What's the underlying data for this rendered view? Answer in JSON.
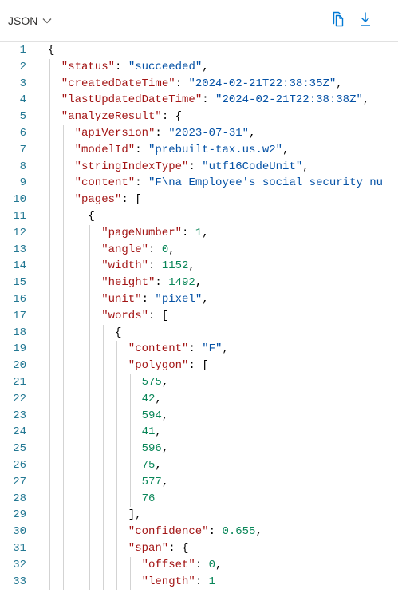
{
  "toolbar": {
    "format_label": "JSON",
    "format_chevron_icon": "chevron-down-icon",
    "copy_icon": "copy-icon",
    "download_icon": "download-icon"
  },
  "colors": {
    "key": "#a31515",
    "string": "#0451a5",
    "number": "#098658",
    "line_number": "#237893",
    "icon": "#0078d4"
  },
  "lines": [
    {
      "n": "1",
      "indent": 0,
      "tokens": [
        {
          "t": "{",
          "c": "p"
        }
      ]
    },
    {
      "n": "2",
      "indent": 1,
      "tokens": [
        {
          "t": "\"status\"",
          "c": "k"
        },
        {
          "t": ": ",
          "c": "p"
        },
        {
          "t": "\"succeeded\"",
          "c": "s"
        },
        {
          "t": ",",
          "c": "p"
        }
      ]
    },
    {
      "n": "3",
      "indent": 1,
      "tokens": [
        {
          "t": "\"createdDateTime\"",
          "c": "k"
        },
        {
          "t": ": ",
          "c": "p"
        },
        {
          "t": "\"2024-02-21T22:38:35Z\"",
          "c": "s"
        },
        {
          "t": ",",
          "c": "p"
        }
      ]
    },
    {
      "n": "4",
      "indent": 1,
      "tokens": [
        {
          "t": "\"lastUpdatedDateTime\"",
          "c": "k"
        },
        {
          "t": ": ",
          "c": "p"
        },
        {
          "t": "\"2024-02-21T22:38:38Z\"",
          "c": "s"
        },
        {
          "t": ",",
          "c": "p"
        }
      ]
    },
    {
      "n": "5",
      "indent": 1,
      "tokens": [
        {
          "t": "\"analyzeResult\"",
          "c": "k"
        },
        {
          "t": ": {",
          "c": "p"
        }
      ]
    },
    {
      "n": "6",
      "indent": 2,
      "tokens": [
        {
          "t": "\"apiVersion\"",
          "c": "k"
        },
        {
          "t": ": ",
          "c": "p"
        },
        {
          "t": "\"2023-07-31\"",
          "c": "s"
        },
        {
          "t": ",",
          "c": "p"
        }
      ]
    },
    {
      "n": "7",
      "indent": 2,
      "tokens": [
        {
          "t": "\"modelId\"",
          "c": "k"
        },
        {
          "t": ": ",
          "c": "p"
        },
        {
          "t": "\"prebuilt-tax.us.w2\"",
          "c": "s"
        },
        {
          "t": ",",
          "c": "p"
        }
      ]
    },
    {
      "n": "8",
      "indent": 2,
      "tokens": [
        {
          "t": "\"stringIndexType\"",
          "c": "k"
        },
        {
          "t": ": ",
          "c": "p"
        },
        {
          "t": "\"utf16CodeUnit\"",
          "c": "s"
        },
        {
          "t": ",",
          "c": "p"
        }
      ]
    },
    {
      "n": "9",
      "indent": 2,
      "tokens": [
        {
          "t": "\"content\"",
          "c": "k"
        },
        {
          "t": ": ",
          "c": "p"
        },
        {
          "t": "\"F\\na Employee's social security nu",
          "c": "s"
        }
      ]
    },
    {
      "n": "10",
      "indent": 2,
      "tokens": [
        {
          "t": "\"pages\"",
          "c": "k"
        },
        {
          "t": ": [",
          "c": "p"
        }
      ]
    },
    {
      "n": "11",
      "indent": 3,
      "tokens": [
        {
          "t": "{",
          "c": "p"
        }
      ]
    },
    {
      "n": "12",
      "indent": 4,
      "tokens": [
        {
          "t": "\"pageNumber\"",
          "c": "k"
        },
        {
          "t": ": ",
          "c": "p"
        },
        {
          "t": "1",
          "c": "n"
        },
        {
          "t": ",",
          "c": "p"
        }
      ]
    },
    {
      "n": "13",
      "indent": 4,
      "tokens": [
        {
          "t": "\"angle\"",
          "c": "k"
        },
        {
          "t": ": ",
          "c": "p"
        },
        {
          "t": "0",
          "c": "n"
        },
        {
          "t": ",",
          "c": "p"
        }
      ]
    },
    {
      "n": "14",
      "indent": 4,
      "tokens": [
        {
          "t": "\"width\"",
          "c": "k"
        },
        {
          "t": ": ",
          "c": "p"
        },
        {
          "t": "1152",
          "c": "n"
        },
        {
          "t": ",",
          "c": "p"
        }
      ]
    },
    {
      "n": "15",
      "indent": 4,
      "tokens": [
        {
          "t": "\"height\"",
          "c": "k"
        },
        {
          "t": ": ",
          "c": "p"
        },
        {
          "t": "1492",
          "c": "n"
        },
        {
          "t": ",",
          "c": "p"
        }
      ]
    },
    {
      "n": "16",
      "indent": 4,
      "tokens": [
        {
          "t": "\"unit\"",
          "c": "k"
        },
        {
          "t": ": ",
          "c": "p"
        },
        {
          "t": "\"pixel\"",
          "c": "s"
        },
        {
          "t": ",",
          "c": "p"
        }
      ]
    },
    {
      "n": "17",
      "indent": 4,
      "tokens": [
        {
          "t": "\"words\"",
          "c": "k"
        },
        {
          "t": ": [",
          "c": "p"
        }
      ]
    },
    {
      "n": "18",
      "indent": 5,
      "tokens": [
        {
          "t": "{",
          "c": "p"
        }
      ]
    },
    {
      "n": "19",
      "indent": 6,
      "tokens": [
        {
          "t": "\"content\"",
          "c": "k"
        },
        {
          "t": ": ",
          "c": "p"
        },
        {
          "t": "\"F\"",
          "c": "s"
        },
        {
          "t": ",",
          "c": "p"
        }
      ]
    },
    {
      "n": "20",
      "indent": 6,
      "tokens": [
        {
          "t": "\"polygon\"",
          "c": "k"
        },
        {
          "t": ": [",
          "c": "p"
        }
      ]
    },
    {
      "n": "21",
      "indent": 7,
      "tokens": [
        {
          "t": "575",
          "c": "n"
        },
        {
          "t": ",",
          "c": "p"
        }
      ]
    },
    {
      "n": "22",
      "indent": 7,
      "tokens": [
        {
          "t": "42",
          "c": "n"
        },
        {
          "t": ",",
          "c": "p"
        }
      ]
    },
    {
      "n": "23",
      "indent": 7,
      "tokens": [
        {
          "t": "594",
          "c": "n"
        },
        {
          "t": ",",
          "c": "p"
        }
      ]
    },
    {
      "n": "24",
      "indent": 7,
      "tokens": [
        {
          "t": "41",
          "c": "n"
        },
        {
          "t": ",",
          "c": "p"
        }
      ]
    },
    {
      "n": "25",
      "indent": 7,
      "tokens": [
        {
          "t": "596",
          "c": "n"
        },
        {
          "t": ",",
          "c": "p"
        }
      ]
    },
    {
      "n": "26",
      "indent": 7,
      "tokens": [
        {
          "t": "75",
          "c": "n"
        },
        {
          "t": ",",
          "c": "p"
        }
      ]
    },
    {
      "n": "27",
      "indent": 7,
      "tokens": [
        {
          "t": "577",
          "c": "n"
        },
        {
          "t": ",",
          "c": "p"
        }
      ]
    },
    {
      "n": "28",
      "indent": 7,
      "tokens": [
        {
          "t": "76",
          "c": "n"
        }
      ]
    },
    {
      "n": "29",
      "indent": 6,
      "tokens": [
        {
          "t": "],",
          "c": "p"
        }
      ]
    },
    {
      "n": "30",
      "indent": 6,
      "tokens": [
        {
          "t": "\"confidence\"",
          "c": "k"
        },
        {
          "t": ": ",
          "c": "p"
        },
        {
          "t": "0.655",
          "c": "n"
        },
        {
          "t": ",",
          "c": "p"
        }
      ]
    },
    {
      "n": "31",
      "indent": 6,
      "tokens": [
        {
          "t": "\"span\"",
          "c": "k"
        },
        {
          "t": ": {",
          "c": "p"
        }
      ]
    },
    {
      "n": "32",
      "indent": 7,
      "tokens": [
        {
          "t": "\"offset\"",
          "c": "k"
        },
        {
          "t": ": ",
          "c": "p"
        },
        {
          "t": "0",
          "c": "n"
        },
        {
          "t": ",",
          "c": "p"
        }
      ]
    },
    {
      "n": "33",
      "indent": 7,
      "tokens": [
        {
          "t": "\"length\"",
          "c": "k"
        },
        {
          "t": ": ",
          "c": "p"
        },
        {
          "t": "1",
          "c": "n"
        }
      ]
    }
  ]
}
